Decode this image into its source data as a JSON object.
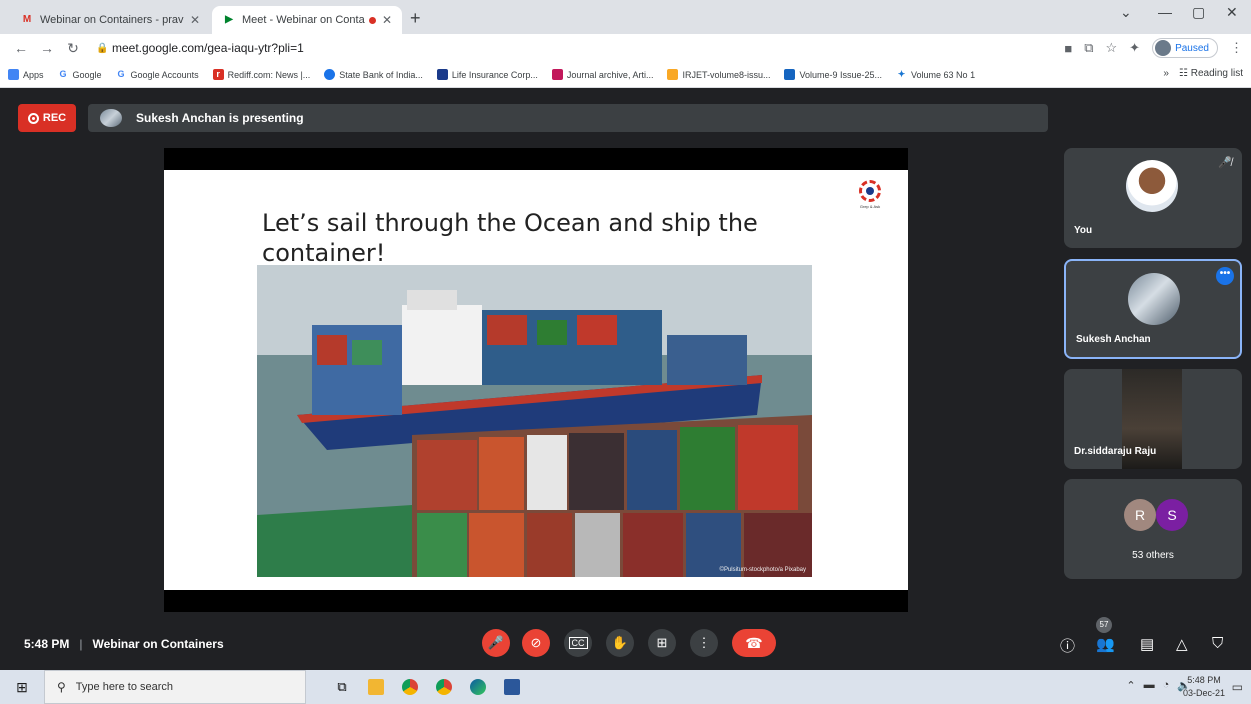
{
  "browser": {
    "tabs": [
      {
        "title": "Webinar on Containers - pravee",
        "active": false
      },
      {
        "title": "Meet - Webinar on Contain",
        "active": true
      }
    ],
    "url": "meet.google.com/gea-iaqu-ytr?pli=1",
    "profile_status": "Paused",
    "bookmarks": [
      "Apps",
      "Google",
      "Google Accounts",
      "Rediff.com: News |...",
      "State Bank of India...",
      "Life Insurance Corp...",
      "Journal archive, Arti...",
      "IRJET-volume8-issu...",
      "Volume-9 Issue-25...",
      "Volume 63 No 1"
    ],
    "reading_list": "Reading list"
  },
  "meet": {
    "rec_label": "REC",
    "presenting_text": "Sukesh Anchan is presenting",
    "slide": {
      "title": "Let’s sail through the Ocean and ship the container!",
      "logo_text": "Grep & Ask",
      "image_credit": "©Pulsitum-stockphoto/a Pixabay"
    },
    "participants": [
      {
        "name": "You"
      },
      {
        "name": "Sukesh Anchan"
      },
      {
        "name": "Dr.siddaraju Raju"
      }
    ],
    "others": {
      "initials": [
        "R",
        "S"
      ],
      "colors": [
        "#a1887f",
        "#7b1fa2"
      ],
      "label": "53 others"
    },
    "time": "5:48 PM",
    "meeting_name": "Webinar on Containers",
    "participant_count": "57"
  },
  "taskbar": {
    "search_placeholder": "Type here to search",
    "clock_time": "5:48 PM",
    "clock_date": "03-Dec-21"
  }
}
